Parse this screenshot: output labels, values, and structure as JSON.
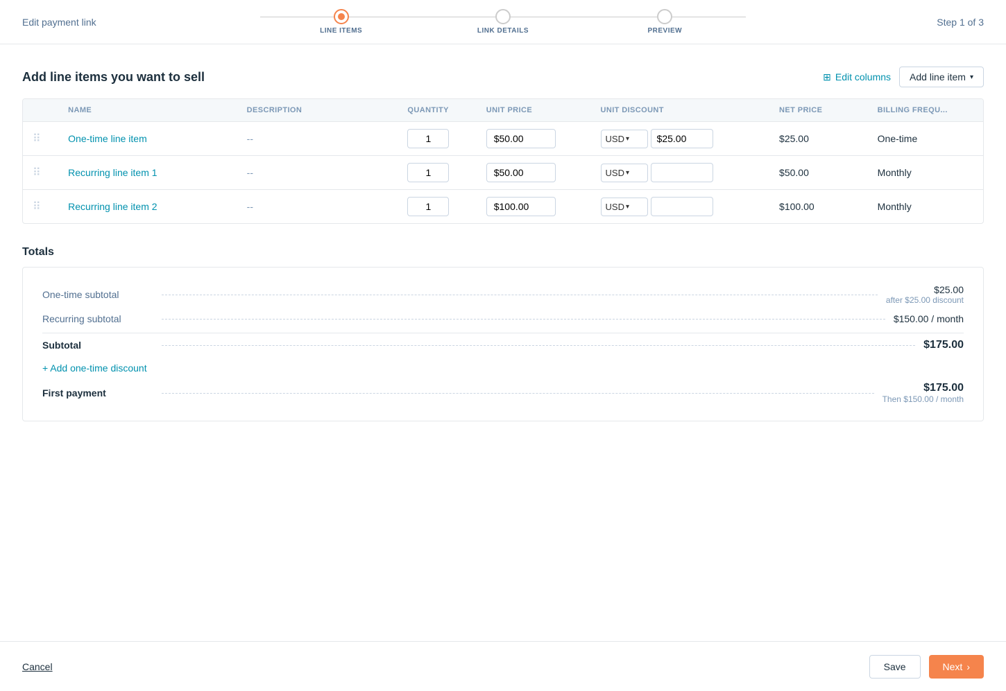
{
  "header": {
    "title": "Edit payment link",
    "step_label": "Step 1 of 3"
  },
  "stepper": {
    "steps": [
      {
        "id": "line-items",
        "label": "LINE ITEMS",
        "state": "active"
      },
      {
        "id": "link-details",
        "label": "LINK DETAILS",
        "state": "inactive"
      },
      {
        "id": "preview",
        "label": "PREVIEW",
        "state": "inactive"
      }
    ]
  },
  "page": {
    "section_title": "Add line items you want to sell",
    "edit_columns_label": "Edit columns",
    "add_line_item_label": "Add line item"
  },
  "table": {
    "columns": [
      "NAME",
      "DESCRIPTION",
      "QUANTITY",
      "UNIT PRICE",
      "UNIT DISCOUNT",
      "NET PRICE",
      "BILLING FREQU..."
    ],
    "rows": [
      {
        "name": "One-time line item",
        "description": "--",
        "quantity": "1",
        "unit_price": "$50.00",
        "currency": "USD",
        "discount": "$25.00",
        "net_price": "$25.00",
        "billing_freq": "One-time"
      },
      {
        "name": "Recurring line item 1",
        "description": "--",
        "quantity": "1",
        "unit_price": "$50.00",
        "currency": "USD",
        "discount": "",
        "net_price": "$50.00",
        "billing_freq": "Monthly"
      },
      {
        "name": "Recurring line item 2",
        "description": "--",
        "quantity": "1",
        "unit_price": "$100.00",
        "currency": "USD",
        "discount": "",
        "net_price": "$100.00",
        "billing_freq": "Monthly"
      }
    ]
  },
  "totals": {
    "title": "Totals",
    "one_time_subtotal_label": "One-time subtotal",
    "one_time_subtotal_value": "$25.00",
    "one_time_subtotal_sub": "after $25.00 discount",
    "recurring_subtotal_label": "Recurring subtotal",
    "recurring_subtotal_value": "$150.00 / month",
    "subtotal_label": "Subtotal",
    "subtotal_value": "$175.00",
    "add_discount_label": "+ Add one-time discount",
    "first_payment_label": "First payment",
    "first_payment_value": "$175.00",
    "first_payment_sub": "Then $150.00 / month"
  },
  "footer": {
    "cancel_label": "Cancel",
    "save_label": "Save",
    "next_label": "Next"
  }
}
